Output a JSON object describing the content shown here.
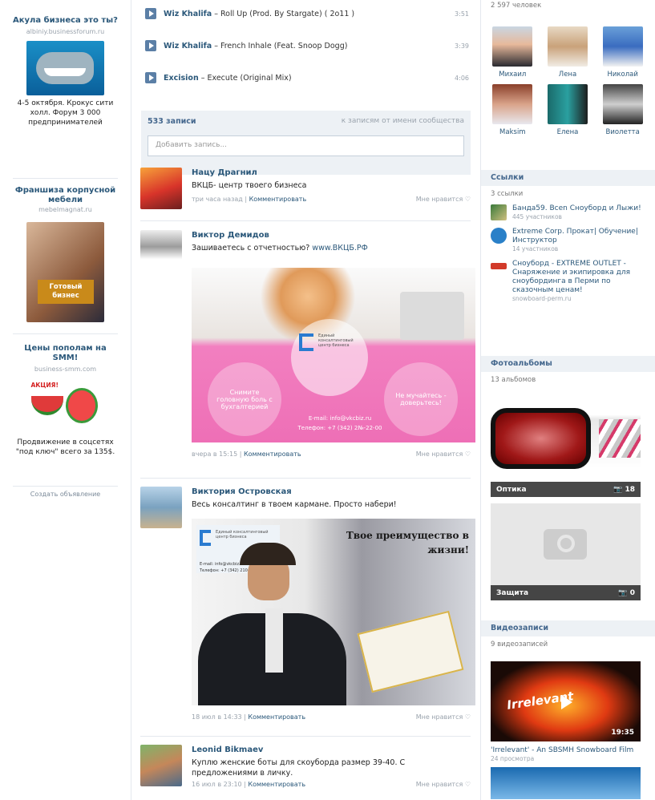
{
  "left_ads": [
    {
      "title": "Акула бизнеса это ты?",
      "sub": "albiniy.businessforum.ru",
      "text": "4-5 октября. Крокус сити холл. Форум 3 000 предпринимателей"
    },
    {
      "title": "Франшиза корпусной мебели",
      "sub": "mebelmagnat.ru",
      "badge": "Готовый бизнес"
    },
    {
      "title": "Цены пополам на SMM!",
      "sub": "business-smm.com",
      "badge2": "АКЦИЯ!",
      "text": "Продвижение в соцсетях \"под ключ\" всего за 135$."
    }
  ],
  "left_footer": "Создать объявление",
  "tracks": [
    {
      "artist": "Wiz Khalifa",
      "title": " – Roll Up (Prod. By Stargate) ( 2o11 )",
      "dur": "3:51"
    },
    {
      "artist": "Wiz Khalifa",
      "title": " – French Inhale (Feat. Snoop Dogg)",
      "dur": "3:39"
    },
    {
      "artist": "Excision",
      "title": " – Execute (Original Mix)",
      "dur": "4:06"
    }
  ],
  "wall": {
    "count": "533 записи",
    "filter": "к записям от имени сообщества",
    "placeholder": "Добавить запись..."
  },
  "posts": [
    {
      "author": "Нацу Драгнил",
      "text": "ВКЦБ- центр твоего бизнеса",
      "time": "три часа назад",
      "comment": "Комментировать",
      "like": "Мне нравится"
    },
    {
      "author": "Виктор Демидов",
      "text": "Зашиваетесь с отчетностью? ",
      "link": "www.ВКЦБ.РФ",
      "time": "вчера в 15:15",
      "comment": "Комментировать",
      "like": "Мне нравится",
      "img_logo": "Единый консалтинговый центр бизнеса",
      "img_email": "E-mail: info@vkcbiz.ru",
      "img_phone": "Телефон: +7 (342) 2№-22-00",
      "img_c1": "Снимите головную боль с бухгалтерией",
      "img_c2": "Не мучайтесь - доверьтесь!"
    },
    {
      "author": "Виктория Островская",
      "text": "Весь консалтинг в твоем кармане. Просто набери!",
      "time": "18 июл в 14:33",
      "comment": "Комментировать",
      "like": "Мне нравится",
      "img_head": "Твое преимущество в жизни!",
      "img_logo": "Единый консалтинговый центр бизнеса",
      "img_email": "E-mail: info@vkcbiz.ru",
      "img_phone": "Телефон: +7 (342) 210-38-38"
    },
    {
      "author": "Leonid Bikmaev",
      "text": "Куплю женские боты для скоуборда размер 39-40. С предложениями в личку.",
      "time": "16 июл в 23:10",
      "comment": "Комментировать",
      "like": "Мне нравится"
    }
  ],
  "members": {
    "count": "2 597 человек",
    "people": [
      "Михаил",
      "Лена",
      "Николай",
      "Maksim",
      "Елена",
      "Виолетта"
    ]
  },
  "links": {
    "title": "Ссылки",
    "count": "3 ссылки",
    "items": [
      {
        "title": "Банда59. Всеn Сноуборд и Лыжи!",
        "sub": "445 участников"
      },
      {
        "title": "Extreme Corp. Прокат| Обучение|Инструктор",
        "sub": "14 участников"
      },
      {
        "title": "Сноуборд - EXTREME OUTLET - Снаряжение и экипировка для сноубординга в Перми по сказочным ценам!",
        "sub": "snowboard-perm.ru"
      }
    ]
  },
  "albums": {
    "title": "Фотоальбомы",
    "count": "13 альбомов",
    "items": [
      {
        "name": "Оптика",
        "n": "18"
      },
      {
        "name": "Защита",
        "n": "0"
      }
    ]
  },
  "videos": {
    "title": "Видеозаписи",
    "count": "9 видеозаписей",
    "item": {
      "title": "'Irrelevant' - An SBSMH Snowboard Film",
      "views": "24 просмотра",
      "dur": "19:35",
      "logo": "Irrelevant"
    }
  },
  "colors": {
    "accent": "#2b587a",
    "header_bg": "#edf1f5"
  }
}
